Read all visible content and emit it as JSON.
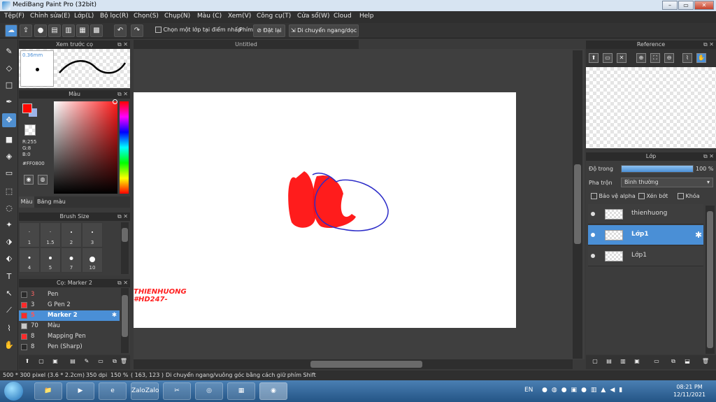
{
  "window": {
    "title": "MediBang Paint Pro (32bit)",
    "min": "–",
    "max": "▭",
    "close": "✕"
  },
  "menu": [
    "Tệp(F)",
    "Chỉnh sửa(E)",
    "Lớp(L)",
    "Bộ lọc(R)",
    "Chọn(S)",
    "Chụp(N)",
    "Màu (C)",
    "Xem(V)",
    "Công cụ(T)",
    "Cửa sổ(W)",
    "Cloud",
    "Help"
  ],
  "toolbar": {
    "select_one_layer": "Chọn một lớp tại điểm nhấp",
    "key_label": "Phím",
    "reset": "Đặt lại",
    "move_hv": "Di chuyển ngang/dọc"
  },
  "canvas": {
    "tab_title": "Untitled",
    "watermark_1": "THIENHUONG",
    "watermark_2": "#HD247-",
    "stroke_color": "#ff0000",
    "line_color": "#2b2bc8"
  },
  "brush_preview": {
    "title": "Xem trước cọ",
    "size": "0.36mm"
  },
  "color_panel": {
    "title": "Màu",
    "fg": "#ff0800",
    "r": "R:255",
    "g": "G:8",
    "b": "B:0",
    "hex": "#FF0800",
    "tabs": [
      "Màu",
      "Bảng màu"
    ]
  },
  "brush_size": {
    "title": "Brush Size",
    "sizes": [
      "1",
      "1.5",
      "2",
      "3",
      "4",
      "5",
      "7",
      "10"
    ]
  },
  "brush_list": {
    "title": "Cọ: Marker 2",
    "items": [
      {
        "size": "3",
        "name": "Pen",
        "swatch": "#2a2a2a"
      },
      {
        "size": "3",
        "name": "G Pen 2",
        "swatch": "#ff2a2a"
      },
      {
        "size": "5",
        "name": "Marker 2",
        "swatch": "#ff2a2a",
        "active": true
      },
      {
        "size": "70",
        "name": "Màu",
        "swatch": "#c8c8c8"
      },
      {
        "size": "8",
        "name": "Mapping Pen",
        "swatch": "#ff2a2a"
      },
      {
        "size": "8",
        "name": "Pen (Sharp)",
        "swatch": "#2a2a2a"
      }
    ]
  },
  "reference": {
    "title": "Reference"
  },
  "layers": {
    "title": "Lớp",
    "opacity_label": "Độ trong",
    "opacity_value": "100 %",
    "opacity_fraction": 1.0,
    "blend_label": "Pha trộn",
    "blend_value": "Bình thường",
    "protect_alpha": "Bảo vệ alpha",
    "clipping": "Xén bớt",
    "lock": "Khóa",
    "items": [
      "thienhuong",
      "Lớp1",
      "Lớp1"
    ]
  },
  "status": {
    "size": "500 * 300 pixel",
    "cm": "(3.6 * 2.2cm)",
    "dpi": "350 dpi",
    "zoom": "150 %",
    "coords": "( 163, 123 )",
    "hint": "Di chuyển ngang/vuông góc bằng cách giữ phím Shift"
  },
  "taskbar": {
    "lang": "EN",
    "time": "08:21 PM",
    "date": "12/11/2021",
    "apps": [
      "",
      "",
      "",
      "",
      "Zalo",
      "",
      "",
      "",
      ""
    ]
  }
}
